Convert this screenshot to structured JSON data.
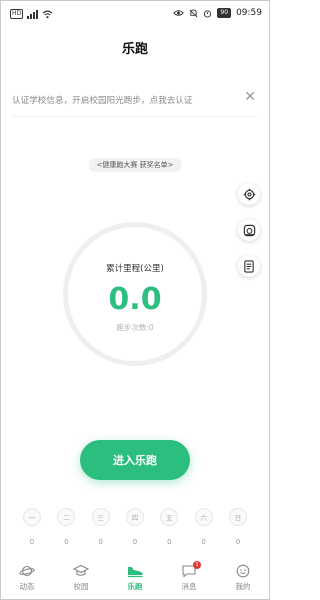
{
  "status_bar": {
    "network_badge": "HD",
    "battery": "90",
    "time": "09:59"
  },
  "header": {
    "title": "乐跑"
  },
  "notice": {
    "text": "认证学校信息，开启校园阳光跑步，点我去认证",
    "close_icon": "close-icon"
  },
  "award_link": "<健康跑大赛 获奖名单>",
  "side_buttons": [
    "settings-icon",
    "camera-icon",
    "records-icon"
  ],
  "stats": {
    "label": "累计里程(公里)",
    "value": "0.0",
    "sub_label": "跑步次数:0"
  },
  "start_button": {
    "label": "进入乐跑"
  },
  "week": [
    {
      "day": "一",
      "count": "0"
    },
    {
      "day": "二",
      "count": "0"
    },
    {
      "day": "三",
      "count": "0"
    },
    {
      "day": "四",
      "count": "0"
    },
    {
      "day": "五",
      "count": "0"
    },
    {
      "day": "六",
      "count": "0"
    },
    {
      "day": "日",
      "count": "0"
    }
  ],
  "tabs": [
    {
      "label": "动态",
      "icon": "planet-icon"
    },
    {
      "label": "校园",
      "icon": "graduation-cap-icon"
    },
    {
      "label": "乐跑",
      "icon": "sneaker-icon",
      "active": true
    },
    {
      "label": "消息",
      "icon": "message-icon",
      "badge": "1"
    },
    {
      "label": "我的",
      "icon": "face-icon"
    }
  ],
  "colors": {
    "accent": "#2bbe7e",
    "badge": "#e53935"
  }
}
